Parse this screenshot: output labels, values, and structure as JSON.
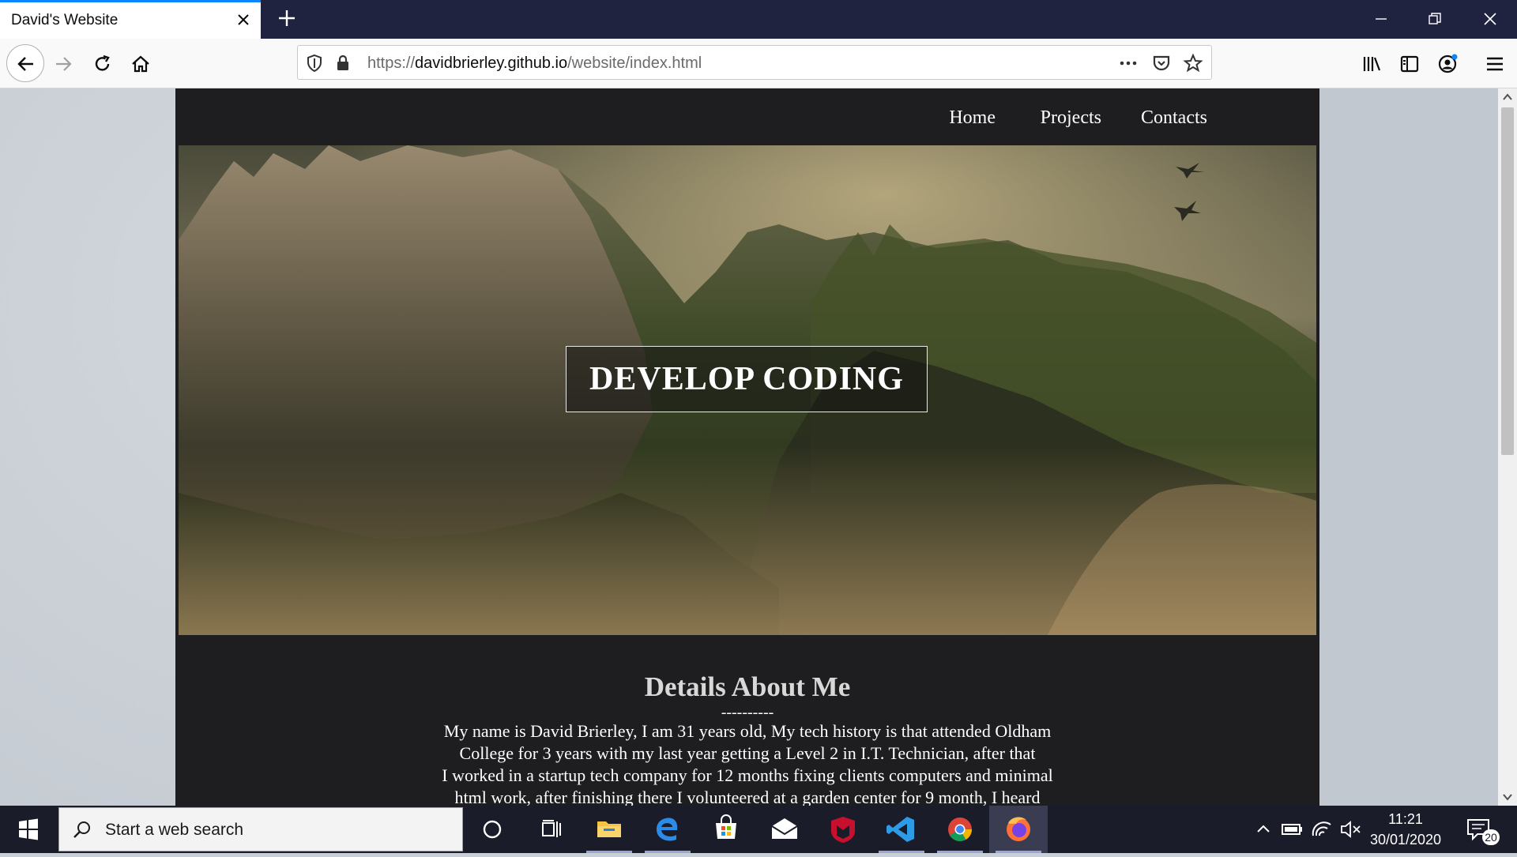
{
  "browser": {
    "tab_title": "David's Website",
    "url_prefix": "https://",
    "url_host": "davidbrierley.github.io",
    "url_path": "/website/index.html"
  },
  "site": {
    "nav": [
      "Home",
      "Projects",
      "Contacts"
    ],
    "hero_title": "DEVELOP CODING",
    "about_heading": "Details About Me",
    "about_separator": "----------",
    "about_lines": [
      "My name is David Brierley, I am 31 years old, My tech history is that attended Oldham",
      "College for 3 years with my last year getting a Level 2 in I.T. Technician, after that",
      "I worked in a startup tech company for 12 months fixing clients computers and minimal",
      "html work, after finishing there I volunteered at a garden center for 9 month, I heard"
    ]
  },
  "taskbar": {
    "search_placeholder": "Start a web search",
    "time": "11:21",
    "date": "30/01/2020",
    "notification_count": "20",
    "apps": [
      "cortana-icon",
      "task-view-icon",
      "file-explorer-icon",
      "edge-icon",
      "store-icon",
      "mail-icon",
      "mcafee-icon",
      "vscode-icon",
      "chrome-icon",
      "firefox-icon"
    ]
  },
  "colors": {
    "accent": "#0a84ff",
    "titlebar": "#202340",
    "site_bg": "#1e1e20",
    "taskbar": "#1a1c2a"
  }
}
